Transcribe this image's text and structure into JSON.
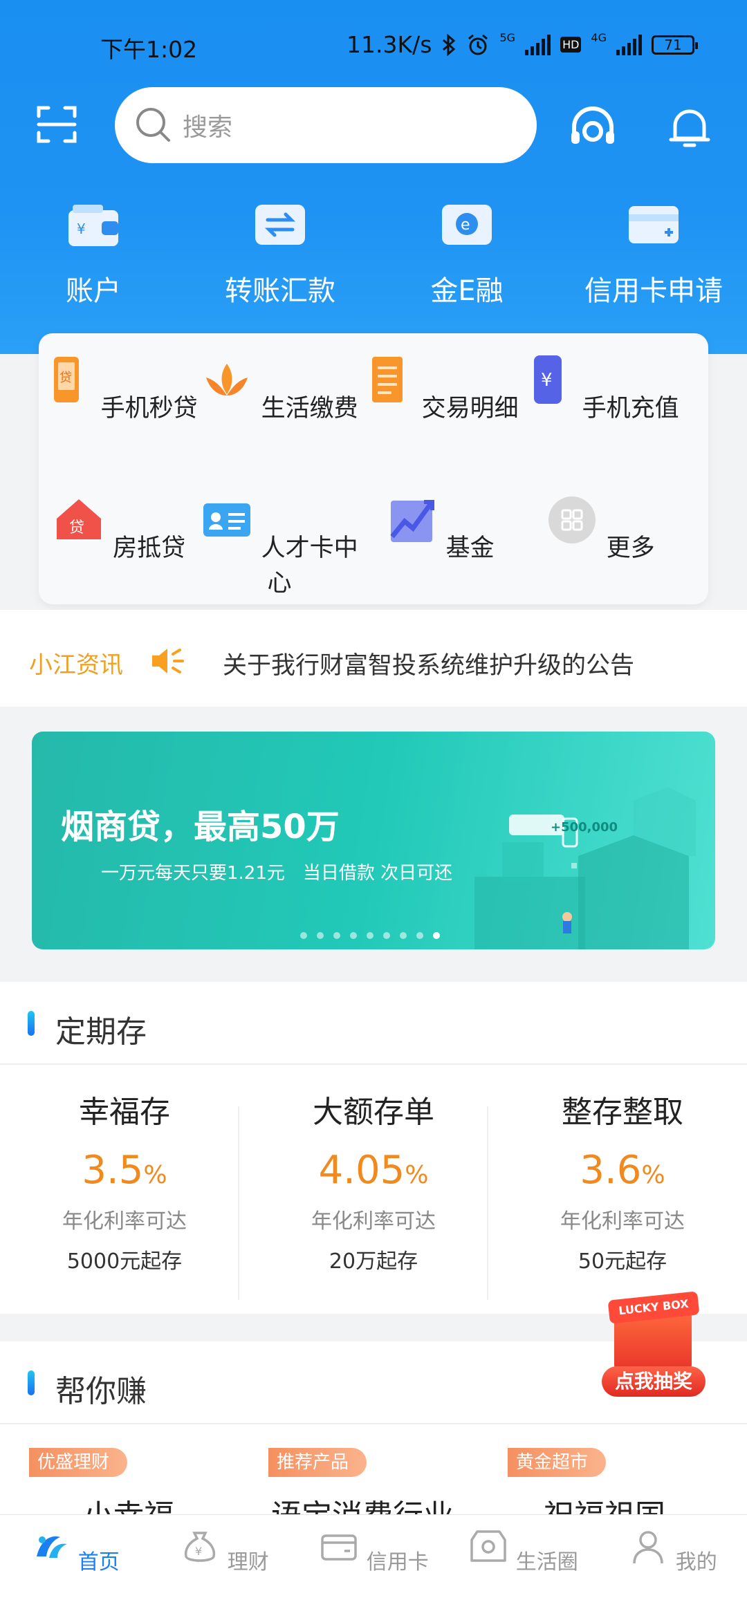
{
  "status": {
    "time": "下午1:02",
    "speed": "11.3K/s",
    "net1": "5G",
    "net2": "4G",
    "hd": "HD",
    "battery": "71"
  },
  "search": {
    "placeholder": "搜索"
  },
  "quick": [
    {
      "label": "账户",
      "icon": "wallet-icon"
    },
    {
      "label": "转账汇款",
      "icon": "transfer-icon"
    },
    {
      "label": "金E融",
      "icon": "e-card-icon"
    },
    {
      "label": "信用卡申请",
      "icon": "credit-card-apply-icon"
    }
  ],
  "grid": [
    {
      "label": "手机秒贷",
      "icon": "phone-loan-icon",
      "color": "#f9962a"
    },
    {
      "label": "生活缴费",
      "icon": "lotus-icon",
      "color": "#f7842a"
    },
    {
      "label": "交易明细",
      "icon": "document-icon",
      "color": "#f8962c"
    },
    {
      "label": "手机充值",
      "icon": "phone-recharge-icon",
      "color": "#5563e6"
    },
    {
      "label": "房抵贷",
      "icon": "house-loan-icon",
      "color": "#f0524a"
    },
    {
      "label": "人才卡中心",
      "icon": "id-card-icon",
      "color": "#3aa6f2"
    },
    {
      "label": "基金",
      "icon": "trend-chart-icon",
      "color": "#4a58e6"
    },
    {
      "label": "更多",
      "icon": "more-grid-icon",
      "color": "#cfcfcf"
    }
  ],
  "notice": {
    "tag": "小江资讯",
    "text": "关于我行财富智投系统维护升级的公告"
  },
  "banner": {
    "title": "烟商贷，最高50万",
    "subtitle": "一万元每天只要1.21元　当日借款 次日可还",
    "badge": "+500,000",
    "dots": 9,
    "active_dot": 8
  },
  "fixed": {
    "title": "定期存",
    "items": [
      {
        "name": "幸福存",
        "rate": "3.5",
        "unit": "%",
        "desc": "年化利率可达",
        "min": "5000元起存"
      },
      {
        "name": "大额存单",
        "rate": "4.05",
        "unit": "%",
        "desc": "年化利率可达",
        "min": "20万起存"
      },
      {
        "name": "整存整取",
        "rate": "3.6",
        "unit": "%",
        "desc": "年化利率可达",
        "min": "50元起存"
      }
    ]
  },
  "earn": {
    "title": "帮你赚",
    "tags": [
      "优盛理财",
      "推荐产品",
      "黄金超市"
    ],
    "titles": [
      "小幸福",
      "语宝消费行业",
      "祝福祖国"
    ]
  },
  "lucky": {
    "lid": "LUCKY BOX",
    "button": "点我抽奖"
  },
  "tabs": [
    {
      "label": "首页",
      "icon": "home-logo-icon",
      "active": true
    },
    {
      "label": "理财",
      "icon": "money-bag-icon",
      "active": false
    },
    {
      "label": "信用卡",
      "icon": "card-icon",
      "active": false
    },
    {
      "label": "生活圈",
      "icon": "life-circle-icon",
      "active": false
    },
    {
      "label": "我的",
      "icon": "user-icon",
      "active": false
    }
  ]
}
